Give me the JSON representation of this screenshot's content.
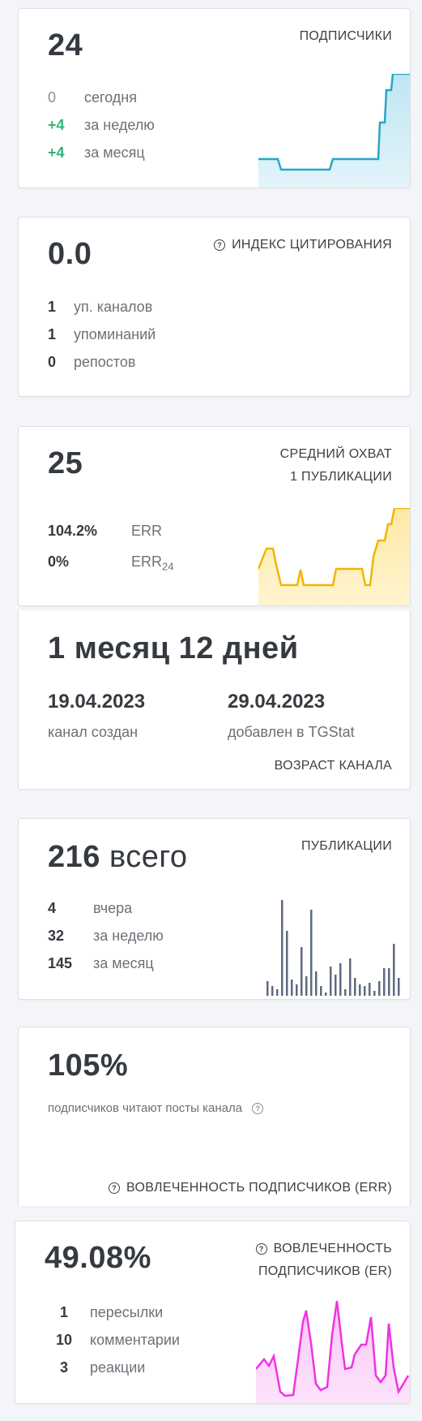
{
  "subscribers": {
    "value": "24",
    "title": "ПОДПИСЧИКИ",
    "rows": [
      {
        "num": "0",
        "label": "сегодня"
      },
      {
        "num": "+4",
        "label": "за неделю"
      },
      {
        "num": "+4",
        "label": "за месяц"
      }
    ],
    "line_color": "#27a6c9"
  },
  "citation": {
    "value": "0.0",
    "title": "ИНДЕКС ЦИТИРОВАНИЯ",
    "help_icon": "question-circle-icon",
    "rows": [
      {
        "num": "1",
        "label": "уп. каналов"
      },
      {
        "num": "1",
        "label": "упоминаний"
      },
      {
        "num": "0",
        "label": "репостов"
      }
    ]
  },
  "reach": {
    "value": "25",
    "title_line1": "СРЕДНИЙ ОХВАТ",
    "title_line2": "1 ПУБЛИКАЦИИ",
    "rows": [
      {
        "num": "104.2%",
        "label": "ERR"
      },
      {
        "num": "0%",
        "label": "ERR",
        "sub": "24"
      }
    ],
    "line_color": "#f2b500"
  },
  "age": {
    "value": "1 месяц 12 дней",
    "created_date": "19.04.2023",
    "created_label": "канал создан",
    "added_date": "29.04.2023",
    "added_label": "добавлен в TGStat",
    "title": "ВОЗРАСТ КАНАЛА"
  },
  "publications": {
    "value_num": "216",
    "value_word": "всего",
    "title": "ПУБЛИКАЦИИ",
    "rows": [
      {
        "num": "4",
        "label": "вчера"
      },
      {
        "num": "32",
        "label": "за неделю"
      },
      {
        "num": "145",
        "label": "за месяц"
      }
    ],
    "bar_color": "#5d6b80"
  },
  "err": {
    "value": "105%",
    "desc": "подписчиков читают посты канала",
    "title": "ВОВЛЕЧЕННОСТЬ ПОДПИСЧИКОВ (ERR)",
    "help_icon": "question-circle-icon"
  },
  "er": {
    "value": "49.08%",
    "title_line1": "ВОВЛЕЧЕННОСТЬ",
    "title_line2": "ПОДПИСЧИКОВ (ER)",
    "help_icon": "question-circle-icon",
    "rows": [
      {
        "num": "1",
        "label": "пересылки"
      },
      {
        "num": "10",
        "label": "комментарии"
      },
      {
        "num": "3",
        "label": "реакции"
      }
    ],
    "line_color": "#ee33e4"
  }
}
